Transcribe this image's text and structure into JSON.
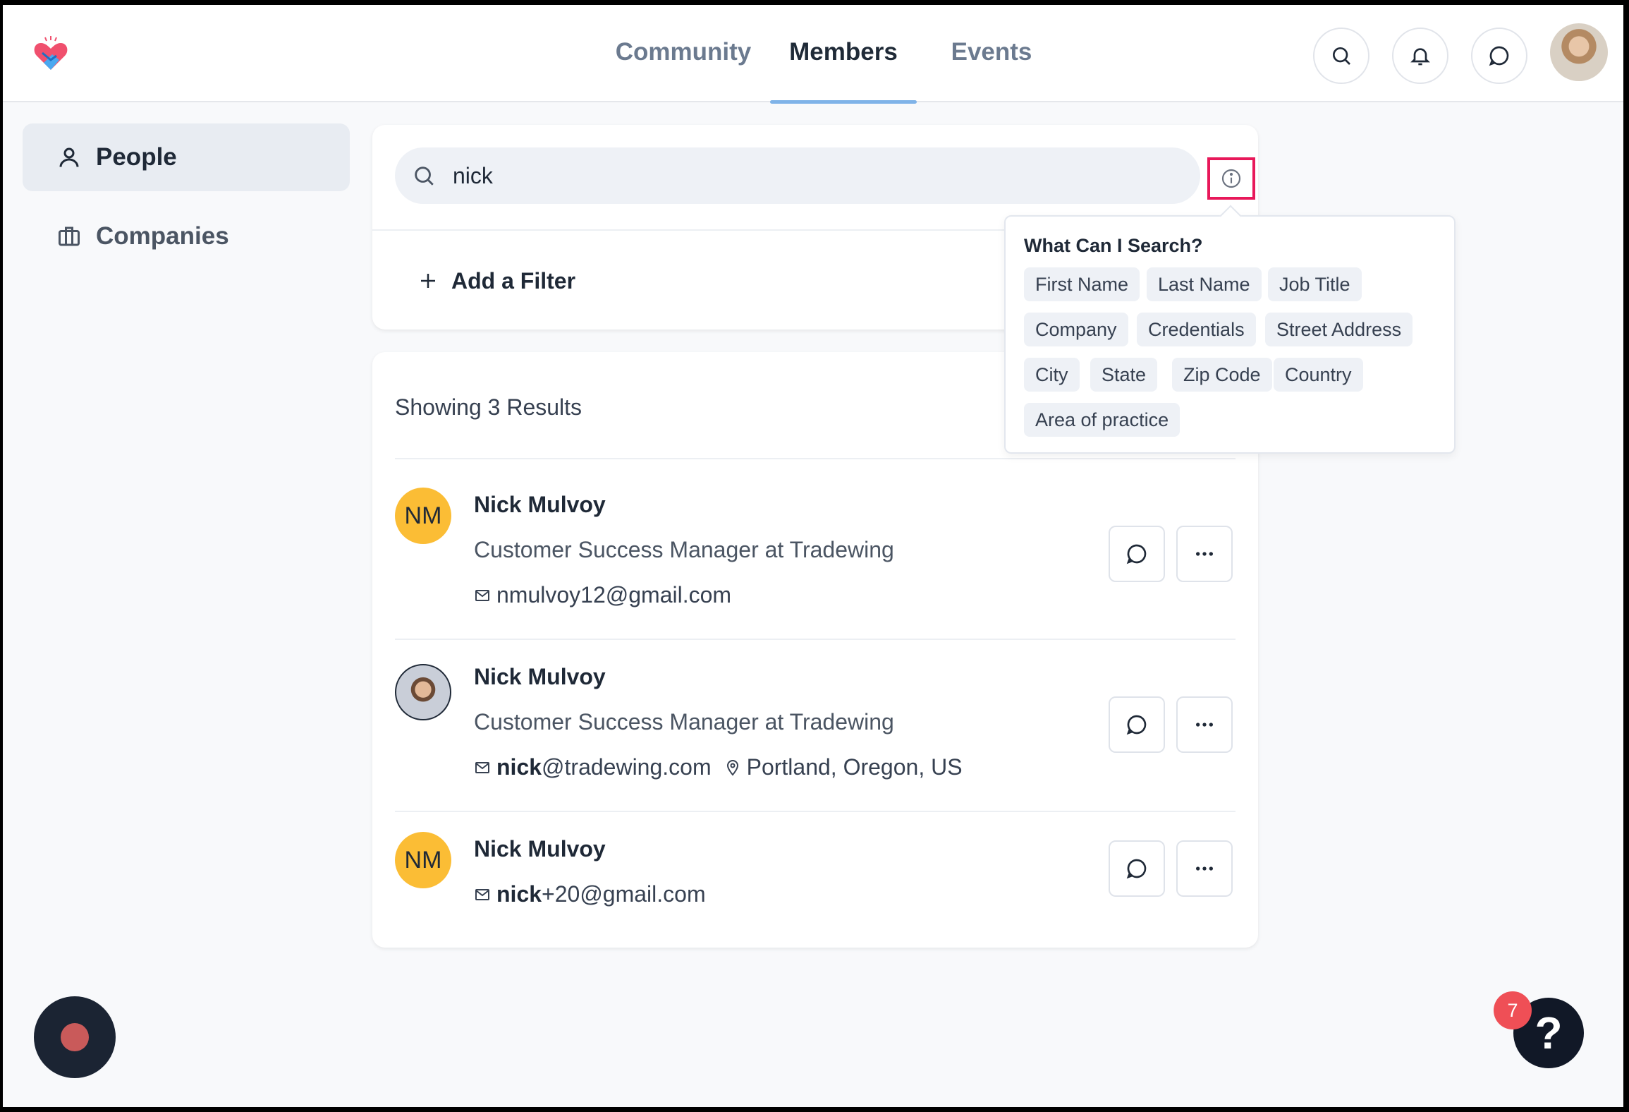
{
  "nav": {
    "tabs": [
      {
        "label": "Community"
      },
      {
        "label": "Members"
      },
      {
        "label": "Events"
      }
    ],
    "active_tab": "Members"
  },
  "sidebar": {
    "items": [
      {
        "label": "People"
      },
      {
        "label": "Companies"
      }
    ]
  },
  "search": {
    "value": "nick",
    "add_filter_label": "Add a Filter"
  },
  "popover": {
    "title": "What Can I Search?",
    "chips": [
      "First Name",
      "Last Name",
      "Job Title",
      "Company",
      "Credentials",
      "Street Address",
      "City",
      "State",
      "Zip Code",
      "Country",
      "Area of practice"
    ]
  },
  "results": {
    "count_label": "Showing 3 Results",
    "people": [
      {
        "initials": "NM",
        "name": "Nick Mulvoy",
        "title": "Customer Success Manager at Tradewing",
        "email_bold": "",
        "email_rest": "nmulvoy12@gmail.com",
        "location": ""
      },
      {
        "initials": "",
        "name": "Nick Mulvoy",
        "title": "Customer Success Manager at Tradewing",
        "email_bold": "nick",
        "email_rest": "@tradewing.com",
        "location": "Portland, Oregon, US"
      },
      {
        "initials": "NM",
        "name": "Nick Mulvoy",
        "title": "",
        "email_bold": "nick",
        "email_rest": "+20@gmail.com",
        "location": ""
      }
    ]
  },
  "help": {
    "badge": "7",
    "symbol": "?"
  },
  "colors": {
    "accent_underline": "#7fb3e8",
    "highlight_border": "#e8185a",
    "avatar_initials_bg": "#fbbd35",
    "badge": "#ef4f56"
  }
}
